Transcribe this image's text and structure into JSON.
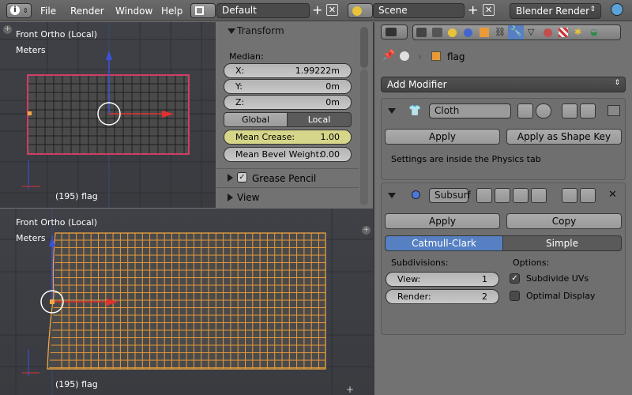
{
  "menu": {
    "file": "File",
    "render": "Render",
    "window": "Window",
    "help": "Help"
  },
  "header": {
    "layout": "Default",
    "scene": "Scene",
    "engine": "Blender Render"
  },
  "viewport_top": {
    "view": "Front Ortho (Local)",
    "units": "Meters",
    "object": "(195) flag"
  },
  "viewport_bottom": {
    "view": "Front Ortho (Local)",
    "units": "Meters",
    "object": "(195) flag"
  },
  "transform": {
    "title": "Transform",
    "median": "Median:",
    "x_label": "X:",
    "x_value": "1.99222m",
    "y_label": "Y:",
    "y_value": "0m",
    "z_label": "Z:",
    "z_value": "0m",
    "global": "Global",
    "local": "Local",
    "crease_label": "Mean Crease:",
    "crease_value": "1.00",
    "bevel_label": "Mean Bevel Weight:",
    "bevel_value": "0.00",
    "grease": "Grease Pencil",
    "view": "View"
  },
  "properties": {
    "object_name": "flag",
    "add_modifier": "Add Modifier",
    "cloth": {
      "name": "Cloth",
      "apply": "Apply",
      "apply_shape": "Apply as Shape Key",
      "info": "Settings are inside the Physics tab"
    },
    "subsurf": {
      "name": "Subsurf",
      "apply": "Apply",
      "copy": "Copy",
      "catmull": "Catmull-Clark",
      "simple": "Simple",
      "subdivisions": "Subdivisions:",
      "options": "Options:",
      "view_label": "View:",
      "view_value": "1",
      "render_label": "Render:",
      "render_value": "2",
      "subdivide_uvs": "Subdivide UVs",
      "optimal_display": "Optimal Display"
    }
  },
  "colors": {
    "accent": "#5680c2",
    "selected_edge": "#f5a742",
    "active_edge": "#ff3c6e",
    "crease": "#d6d68a"
  }
}
